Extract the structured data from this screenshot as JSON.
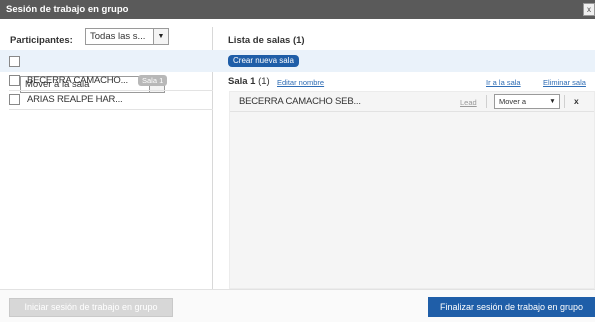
{
  "window": {
    "title": "Sesión de trabajo en grupo",
    "close_label": "x"
  },
  "participants": {
    "label": "Participantes:",
    "filter_selected": "Todas las s...",
    "move_to_room_selected": "Mover a la sala",
    "rows": [
      {
        "name": "BECERRA CAMACHO...",
        "badge": "Sala 1"
      },
      {
        "name": "ARIAS REALPE HAR...",
        "badge": ""
      }
    ]
  },
  "rooms": {
    "list_title": "Lista de salas (1)",
    "create_label": "Crear nueva sala",
    "room": {
      "name": "Sala 1",
      "count": "(1)",
      "edit_label": "Editar nombre",
      "go_label": "Ir a la sala",
      "delete_label": "Eliminar sala",
      "members": [
        {
          "name": "BECERRA CAMACHO SEB...",
          "lead_label": "Lead",
          "move_selected": "Mover a",
          "remove_label": "x"
        }
      ]
    }
  },
  "footer": {
    "start_label": "Iniciar sesión de trabajo en grupo",
    "end_label": "Finalizar sesión de trabajo en grupo"
  },
  "colors": {
    "titlebar": "#5a5a5a",
    "accent": "#1f5ea8",
    "toolbar": "#eaf2fa",
    "link": "#2f6db5"
  },
  "icons": {
    "dropdown": "chevron-down-icon",
    "close": "close-icon"
  }
}
